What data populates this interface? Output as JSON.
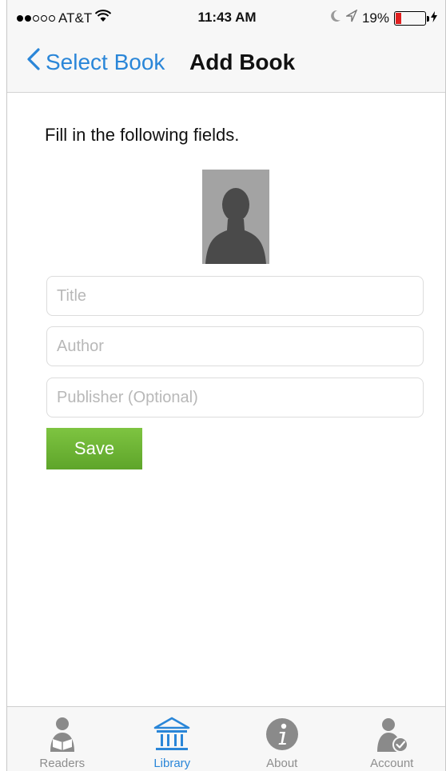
{
  "status_bar": {
    "carrier": "AT&T",
    "time": "11:43 AM",
    "battery_percent": "19%",
    "battery_level": 0.19,
    "icons": [
      "signal-dots-icon",
      "wifi-icon",
      "moon-icon",
      "location-arrow-icon",
      "battery-icon",
      "charging-icon"
    ]
  },
  "nav": {
    "back_label": "Select Book",
    "title": "Add Book"
  },
  "form": {
    "instructions": "Fill in the following fields.",
    "title_placeholder": "Title",
    "author_placeholder": "Author",
    "publisher_placeholder": "Publisher (Optional)",
    "save_label": "Save"
  },
  "tabs": [
    {
      "label": "Readers",
      "icon": "reader-icon",
      "active": false
    },
    {
      "label": "Library",
      "icon": "library-icon",
      "active": true
    },
    {
      "label": "About",
      "icon": "info-icon",
      "active": false
    },
    {
      "label": "Account",
      "icon": "account-icon",
      "active": false
    }
  ],
  "colors": {
    "accent": "#2a86d8",
    "save_button": "#6db535",
    "battery_low": "#e02020",
    "placeholder_bg": "#a3a3a3",
    "tab_inactive": "#8e8e8e"
  }
}
